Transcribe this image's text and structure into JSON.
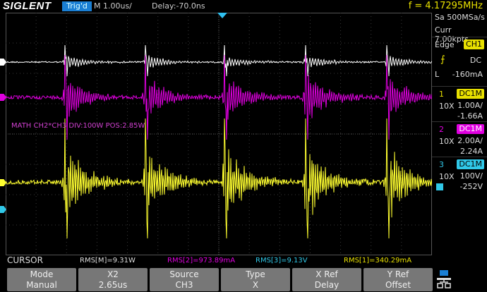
{
  "header": {
    "brand": "SIGLENT",
    "trigger_status": "Trig'd",
    "timebase": "M 1.00us/",
    "delay": "Delay:-70.0ns",
    "frequency": "f = 4.17295MHz"
  },
  "acquisition": {
    "sample_rate": "Sa 500MSa/s",
    "memory": "Curr 7.00kpts"
  },
  "trigger": {
    "type": "Edge",
    "source": "CH1",
    "coupling": "DC",
    "level": "-160mA"
  },
  "channels": [
    {
      "num": "1",
      "coupling": "DC1M",
      "probe": "10X",
      "scale": "1.00A/",
      "offset": "-1.66A",
      "color": "#ffffff"
    },
    {
      "num": "2",
      "coupling": "DC1M",
      "probe": "10X",
      "scale": "2.00A/",
      "offset": "2.24A",
      "color": "#e000e0"
    },
    {
      "num": "3",
      "coupling": "DC1M",
      "probe": "10X",
      "scale": "100V/",
      "offset": "-252V",
      "color": "#ffff30"
    }
  ],
  "math": {
    "label": "MATH  CH2*CH3  DIV:100W  POS:2.85W"
  },
  "measurements": {
    "mode": "CURSOR",
    "rms_m": "RMS[M]=9.31W",
    "rms_2": "RMS[2]=973.89mA",
    "rms_3": "RMS[3]=9.13V",
    "rms_1": "RMS[1]=340.29mA"
  },
  "softkeys": [
    {
      "top": "Mode",
      "bottom": "Manual"
    },
    {
      "top": "X2",
      "bottom": "2.65us"
    },
    {
      "top": "Source",
      "bottom": "CH3"
    },
    {
      "top": "Type",
      "bottom": "X"
    },
    {
      "top": "X Ref",
      "bottom": "Delay"
    },
    {
      "top": "Y Ref",
      "bottom": "Offset"
    }
  ],
  "colors": {
    "ch1": "#ffffff",
    "ch2": "#e000e0",
    "ch3": "#ffff30",
    "math": "#d040d0",
    "ch4_marker": "#30c8e8",
    "accent": "#1a7fd4"
  }
}
